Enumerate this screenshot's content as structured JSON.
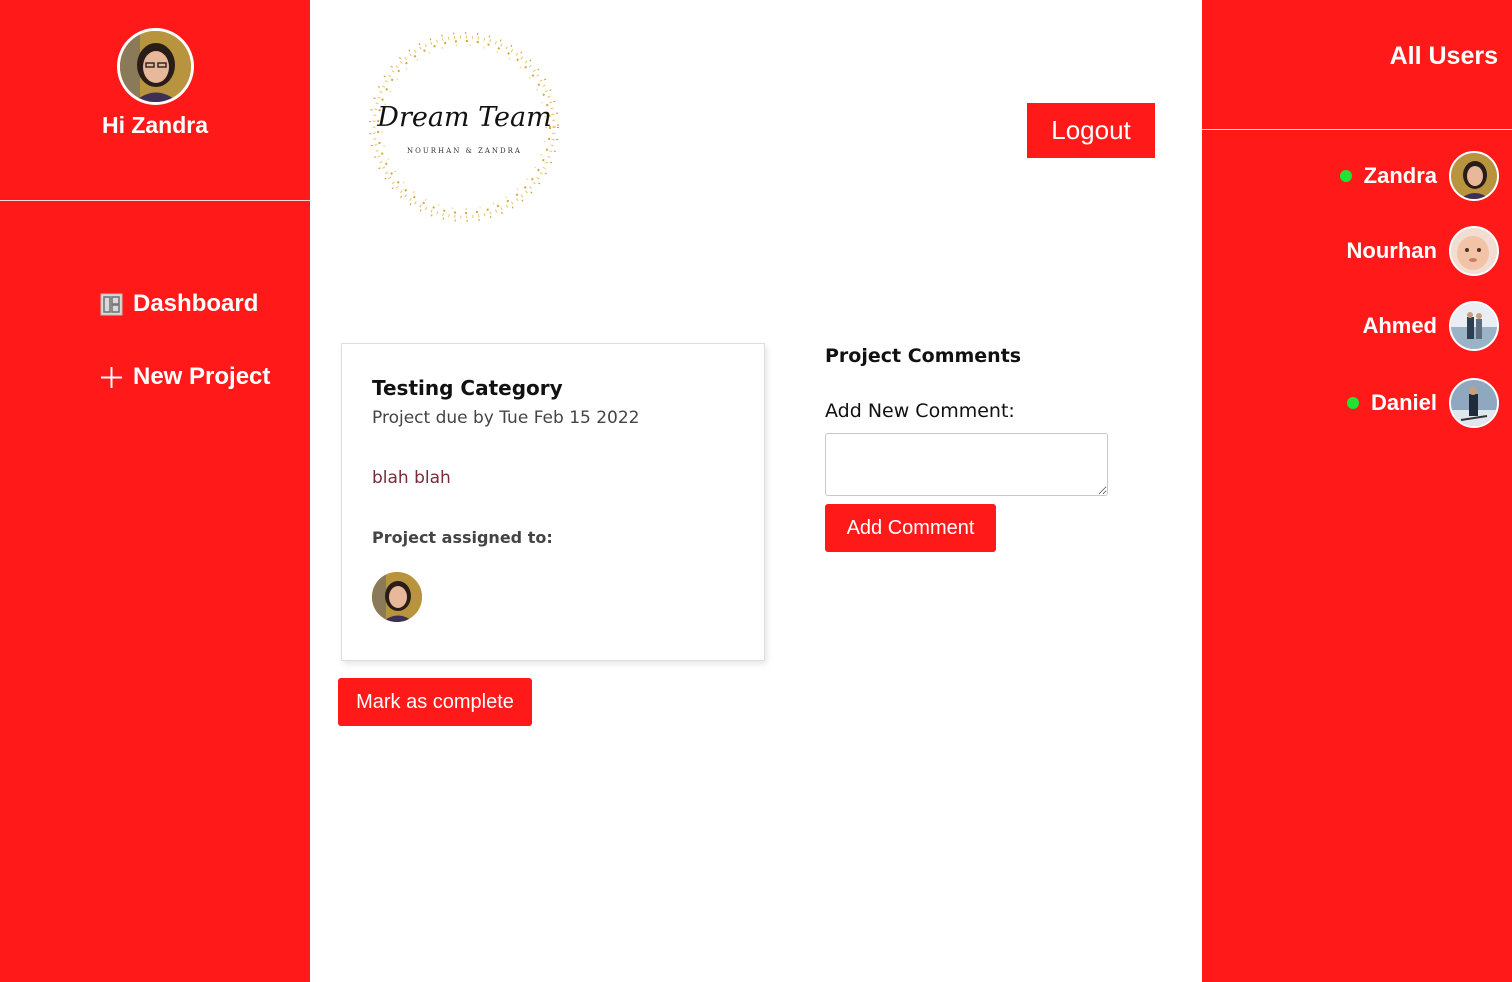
{
  "sidebar": {
    "greeting": "Hi Zandra",
    "nav": [
      {
        "label": "Dashboard",
        "icon": "dashboard-icon"
      },
      {
        "label": "New Project",
        "icon": "plus-icon"
      }
    ]
  },
  "header": {
    "logo_title": "Dream Team",
    "logo_subtitle": "NOURHAN & ZANDRA",
    "logout_label": "Logout"
  },
  "project": {
    "title": "Testing Category",
    "due": "Project due by Tue Feb 15 2022",
    "details": "blah blah",
    "assigned_label": "Project assigned to:",
    "complete_label": "Mark as complete"
  },
  "comments": {
    "title": "Project Comments",
    "label": "Add New Comment:",
    "value": "",
    "button_label": "Add Comment"
  },
  "users": {
    "title": "All Users",
    "list": [
      {
        "name": "Zandra",
        "online": true
      },
      {
        "name": "Nourhan",
        "online": false
      },
      {
        "name": "Ahmed",
        "online": false
      },
      {
        "name": "Daniel",
        "online": true
      }
    ]
  },
  "colors": {
    "accent": "#ff1919",
    "online": "#22e233"
  }
}
